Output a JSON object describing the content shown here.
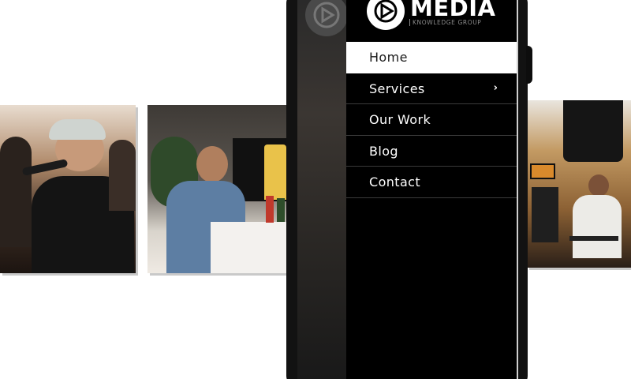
{
  "brand": {
    "name": "MEDIA",
    "tagline": "KNOWLEDGE GROUP"
  },
  "nav": {
    "items": [
      {
        "label": "Home",
        "active": true
      },
      {
        "label": "Services",
        "has_submenu": true
      },
      {
        "label": "Our Work"
      },
      {
        "label": "Blog"
      },
      {
        "label": "Contact"
      }
    ],
    "chevron": "›"
  },
  "icons": {
    "brand_logo": "play-triangle-logo-icon",
    "submenu": "chevron-right-icon"
  },
  "colors": {
    "menu_bg": "#000000",
    "active_bg": "#ffffff",
    "active_text": "#1a1a1a",
    "text": "#ffffff"
  }
}
